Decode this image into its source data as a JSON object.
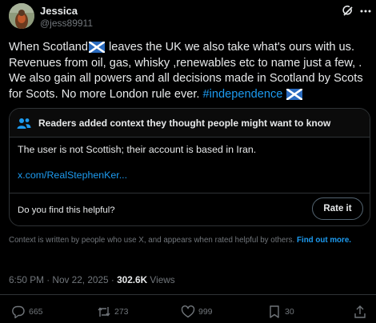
{
  "author": {
    "name": "Jessica",
    "handle": "@jess89911"
  },
  "tweet": {
    "text_a": "When Scotland",
    "text_b": " leaves the UK we also take what's ours with us. Revenues from oil, gas, whisky ,renewables etc to name just a few, . We also gain all powers and all decisions made in Scotland by Scots for Scots. No more London rule ever. ",
    "hashtag": "#independence",
    "flag_icon": "scotland-flag-icon"
  },
  "community_note": {
    "title": "Readers added context they thought people might want to know",
    "body": "The user is not Scottish; their account is based in Iran.",
    "link": "x.com/RealStephenKer...",
    "question": "Do you find this helpful?",
    "rate_label": "Rate it"
  },
  "disclaimer": {
    "text": "Context is written by people who use X, and appears when rated helpful by others. ",
    "link": "Find out more."
  },
  "meta": {
    "time": "6:50 PM",
    "sep": " · ",
    "date": "Nov 22, 2025",
    "views_sep": " · ",
    "views_count": "302.6K",
    "views_label": " Views"
  },
  "actions": {
    "replies": "665",
    "reposts": "273",
    "likes": "999",
    "bookmarks": "30"
  },
  "colors": {
    "background": "#000000",
    "text": "#e7e9ea",
    "muted": "#71767b",
    "accent": "#1d9bf0",
    "border": "#2f3336"
  }
}
